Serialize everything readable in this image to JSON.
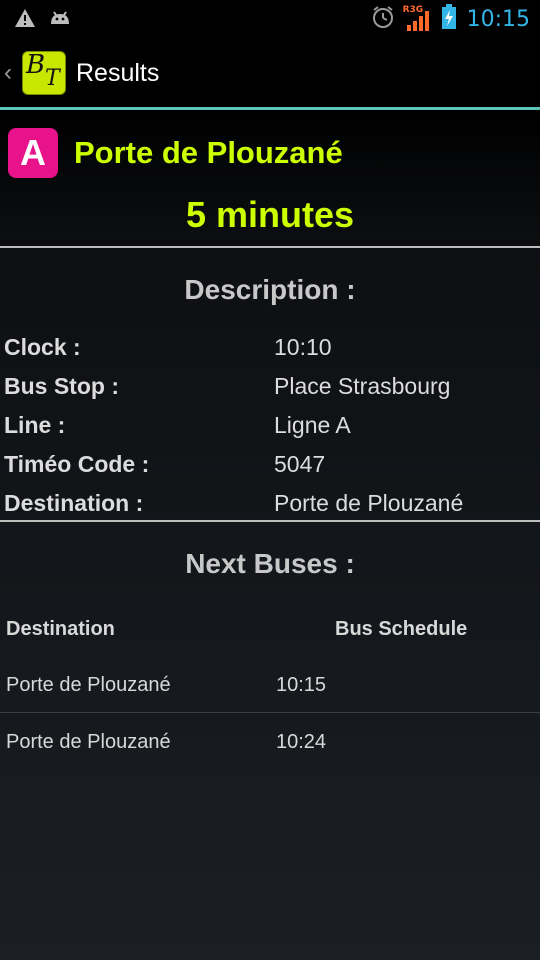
{
  "status_bar": {
    "time": "10:15",
    "network_label": "R3G",
    "icons": [
      "warning-icon",
      "android-icon",
      "alarm-icon",
      "signal-icon",
      "battery-icon"
    ]
  },
  "action_bar": {
    "title": "Results",
    "logo_b": "B",
    "logo_t": "T",
    "accent_line_color": "#5dc5b8"
  },
  "header": {
    "line_letter": "A",
    "line_color": "#e8128a",
    "destination": "Porte de Plouzané",
    "minutes": "5 minutes",
    "highlight_color": "#ccff00"
  },
  "description": {
    "title": "Description :",
    "rows": [
      {
        "label": "Clock :",
        "value": "10:10"
      },
      {
        "label": "Bus Stop :",
        "value": "Place Strasbourg"
      },
      {
        "label": "Line :",
        "value": "Ligne A"
      },
      {
        "label": "Timéo Code :",
        "value": "5047"
      },
      {
        "label": "Destination :",
        "value": "Porte de Plouzané"
      }
    ]
  },
  "next_buses": {
    "title": "Next Buses :",
    "columns": [
      "Destination",
      "Bus Schedule"
    ],
    "rows": [
      {
        "destination": "Porte de Plouzané",
        "schedule": "10:15"
      },
      {
        "destination": "Porte de Plouzané",
        "schedule": "10:24"
      }
    ]
  }
}
